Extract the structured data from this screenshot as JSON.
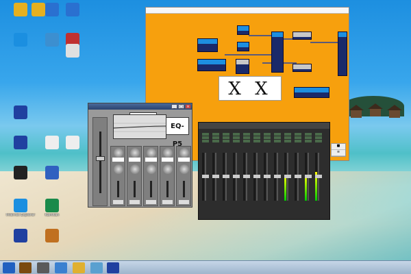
{
  "desktop": {
    "icons": [
      {
        "label": "",
        "icon": "folder-icon",
        "color": "#e6b020"
      },
      {
        "label": "",
        "icon": "folder-icon",
        "color": "#e6b020"
      },
      {
        "label": "",
        "icon": "app-icon",
        "color": "#2a70d0"
      },
      {
        "label": "",
        "icon": "kuaijie-app-icon",
        "color": "#2a70d0"
      },
      {
        "label": "",
        "icon": "ie-icon",
        "color": "#1b8fe0"
      },
      {
        "label": "",
        "icon": "app-icon",
        "color": "#3c8fd0"
      },
      {
        "label": "",
        "icon": "app-icon",
        "color": "#c03030"
      },
      {
        "label": "",
        "icon": "file-icon",
        "color": "#e0e0e0"
      },
      {
        "label": "",
        "icon": "xcode-icon",
        "color": "#2040a0"
      },
      {
        "label": "",
        "icon": "xcode-icon",
        "color": "#2040a0"
      },
      {
        "label": "",
        "icon": "doc-icon",
        "color": "#eeeeee"
      },
      {
        "label": "",
        "icon": "qq-icon",
        "color": "#222222"
      },
      {
        "label": "",
        "icon": "app-icon",
        "color": "#3060c0"
      },
      {
        "label": "",
        "icon": "doc-icon",
        "color": "#eeeeee"
      },
      {
        "label": "Internet Explorer",
        "icon": "ie-icon",
        "color": "#1b8fe0"
      },
      {
        "label": "Kamitan",
        "icon": "app-icon",
        "color": "#1a8a4a"
      },
      {
        "label": "",
        "icon": "xcode-icon",
        "color": "#2040a0"
      },
      {
        "label": "",
        "icon": "box-icon",
        "color": "#c07020"
      }
    ]
  },
  "main_window": {
    "title": "",
    "title_red": "",
    "logo": "X X",
    "modules": [
      {
        "label": "",
        "num": ""
      },
      {
        "label": "",
        "num": ""
      },
      {
        "label": "",
        "num": ""
      },
      {
        "label": "",
        "num": ""
      },
      {
        "label": "",
        "num": ""
      },
      {
        "label": "",
        "num": ""
      },
      {
        "label": "",
        "num": ""
      },
      {
        "label": "",
        "num": ""
      },
      {
        "label": "",
        "num": ""
      },
      {
        "label": "",
        "num": ""
      },
      {
        "label": "",
        "num": ""
      }
    ],
    "side_value": ""
  },
  "eq_window": {
    "title": "",
    "logo": "EQ-P5",
    "preset": "",
    "bands": [
      {
        "value": "",
        "level": 0.6
      },
      {
        "value": "",
        "level": 0.5
      },
      {
        "value": "",
        "level": 0.55
      },
      {
        "value": "",
        "level": 0.5
      },
      {
        "value": "",
        "level": 0.6
      }
    ]
  },
  "mixer_window": {
    "title": "",
    "channels": [
      {
        "label": "",
        "level": 0.0
      },
      {
        "label": "",
        "level": 0.0
      },
      {
        "label": "",
        "level": 0.0
      },
      {
        "label": "",
        "level": 0.0
      },
      {
        "label": "",
        "level": 0.0
      },
      {
        "label": "",
        "level": 0.0
      },
      {
        "label": "",
        "level": 0.0
      },
      {
        "label": "",
        "level": 0.0
      },
      {
        "label": "",
        "level": 0.55
      },
      {
        "label": "",
        "level": 0.0
      },
      {
        "label": "",
        "level": 0.55
      },
      {
        "label": "",
        "level": 0.6
      }
    ]
  },
  "taskbar": {
    "items": [
      "start-button",
      "prof-app",
      "media-app",
      "explorer-app",
      "folder-app",
      "app",
      "xcode-app"
    ],
    "clock": ""
  }
}
